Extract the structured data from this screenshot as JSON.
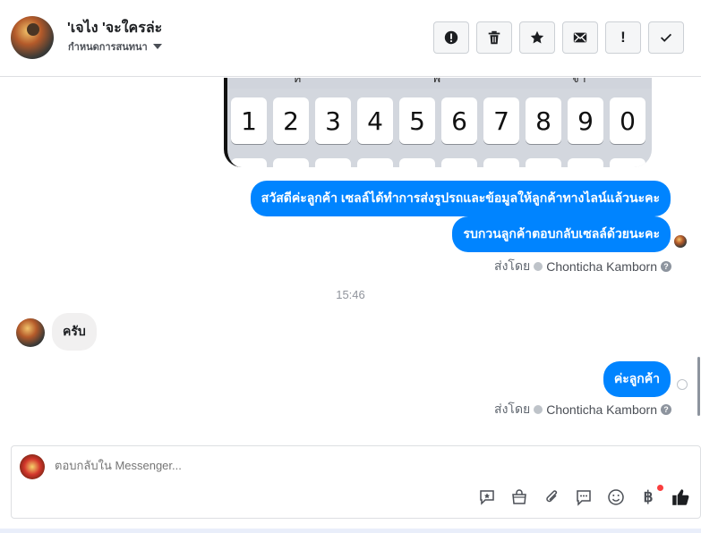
{
  "header": {
    "contact_name": "'เจไง 'จะใครล่ะ",
    "assign_label": "กำหนดการสนทนา",
    "actions": [
      {
        "name": "report-button",
        "icon": "alert-circle-icon"
      },
      {
        "name": "delete-button",
        "icon": "trash-icon"
      },
      {
        "name": "star-button",
        "icon": "star-icon"
      },
      {
        "name": "mark-unread-button",
        "icon": "envelope-icon"
      },
      {
        "name": "follow-up-button",
        "icon": "exclamation-icon",
        "label": "!"
      },
      {
        "name": "mark-done-button",
        "icon": "check-icon"
      }
    ]
  },
  "thread": {
    "keyboard_keys": [
      "1",
      "2",
      "3",
      "4",
      "5",
      "6",
      "7",
      "8",
      "9",
      "0"
    ],
    "keyboard_top_row": [
      "ห",
      "พ",
      "จํา"
    ],
    "messages": [
      {
        "direction": "out",
        "text": "สวัสดีค่ะลูกค้า เซลล์ได้ทำการส่งรูปรถและข้อมูลให้ลูกค้าทางไลน์แล้วนะคะ"
      },
      {
        "direction": "out",
        "text": "รบกวนลูกค้าตอบกลับเซลล์ด้วยนะคะ"
      },
      {
        "direction": "in",
        "text": "ครับ"
      },
      {
        "direction": "out",
        "text": "ค่ะลูกค้า"
      }
    ],
    "sent_by_label": "ส่งโดย",
    "sent_by_name": "Chonticha Kamborn",
    "time_separator": "15:46"
  },
  "composer": {
    "placeholder": "ตอบกลับใน Messenger...",
    "baht_symbol": "฿",
    "colors": {
      "accent": "#0084ff",
      "notification": "#fa3e3e"
    }
  }
}
